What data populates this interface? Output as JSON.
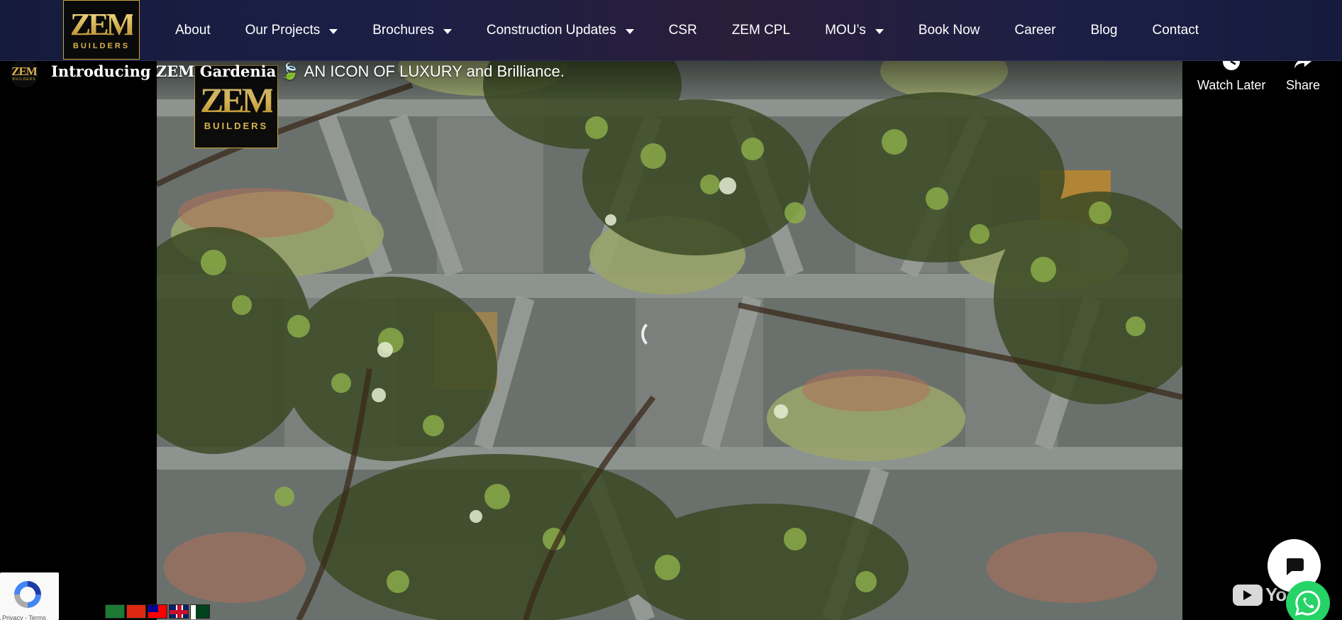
{
  "brand": {
    "logo_text": "ZEM",
    "logo_subtext": "BUILDERS",
    "accent_gold": "#c9a33d",
    "nav_bg": "#1c1f45"
  },
  "nav": {
    "items": [
      {
        "label": "About",
        "has_dropdown": false
      },
      {
        "label": "Our Projects",
        "has_dropdown": true
      },
      {
        "label": "Brochures",
        "has_dropdown": true
      },
      {
        "label": "Construction Updates",
        "has_dropdown": true
      },
      {
        "label": "CSR",
        "has_dropdown": false
      },
      {
        "label": "ZEM CPL",
        "has_dropdown": false
      },
      {
        "label": "MOU’s",
        "has_dropdown": true
      },
      {
        "label": "Book Now",
        "has_dropdown": false
      },
      {
        "label": "Career",
        "has_dropdown": false
      },
      {
        "label": "Blog",
        "has_dropdown": false
      },
      {
        "label": "Contact",
        "has_dropdown": false
      }
    ]
  },
  "video": {
    "title_bold": "Introducing ZEM Gardenia",
    "title_emoji": "🍃",
    "title_rest": "AN ICON OF LUXURY and Brilliance.",
    "actions": {
      "watch_later": "Watch Later",
      "share": "Share"
    },
    "watermark": "Yo",
    "icons": {
      "watch_later": "clock-icon",
      "share": "share-arrow-icon",
      "loading": "spinner-icon"
    }
  },
  "recaptcha": {
    "footer_text": "Privacy - Terms"
  },
  "language_flags": [
    {
      "name": "arabic-flag"
    },
    {
      "name": "chinese-flag"
    },
    {
      "name": "taiwan-flag"
    },
    {
      "name": "english-flag"
    },
    {
      "name": "urdu-flag"
    }
  ],
  "widgets": {
    "chat": "chat-icon",
    "whatsapp": "whatsapp-icon"
  }
}
